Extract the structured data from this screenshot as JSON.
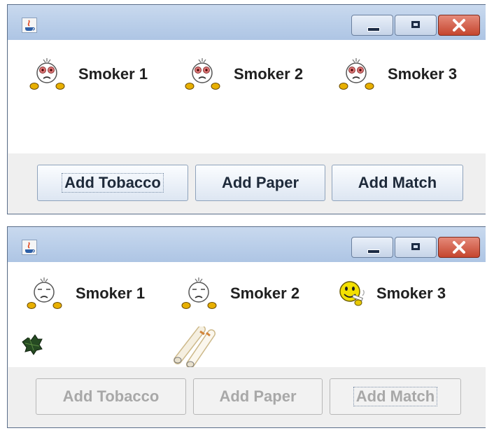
{
  "window1": {
    "smokers": [
      {
        "label": "Smoker 1",
        "state": "waiting"
      },
      {
        "label": "Smoker 2",
        "state": "waiting"
      },
      {
        "label": "Smoker 3",
        "state": "waiting"
      }
    ],
    "buttons": [
      {
        "label": "Add Tobacco",
        "enabled": true,
        "focused": true
      },
      {
        "label": "Add Paper",
        "enabled": true,
        "focused": false
      },
      {
        "label": "Add Match",
        "enabled": true,
        "focused": false
      }
    ]
  },
  "window2": {
    "smokers": [
      {
        "label": "Smoker 1",
        "state": "waiting"
      },
      {
        "label": "Smoker 2",
        "state": "waiting"
      },
      {
        "label": "Smoker 3",
        "state": "smoking"
      }
    ],
    "table_items": [
      "tobacco-leaf",
      "rolling-paper"
    ],
    "buttons": [
      {
        "label": "Add Tobacco",
        "enabled": false,
        "focused": false
      },
      {
        "label": "Add Paper",
        "enabled": false,
        "focused": false
      },
      {
        "label": "Add Match",
        "enabled": false,
        "focused": true
      }
    ]
  },
  "icons": {
    "app": "java-app-icon",
    "minimize": "minimize-icon",
    "maximize": "maximize-icon",
    "close": "close-icon",
    "waiting_smoker": "sad-smoker-icon",
    "smoking_smoker": "smiling-smoker-icon",
    "tobacco": "tobacco-leaf-icon",
    "paper": "rolling-paper-icon"
  },
  "colors": {
    "titlebar": "#bcd0ea",
    "close_button": "#c5452e",
    "disabled_text": "#a8a8a8"
  }
}
